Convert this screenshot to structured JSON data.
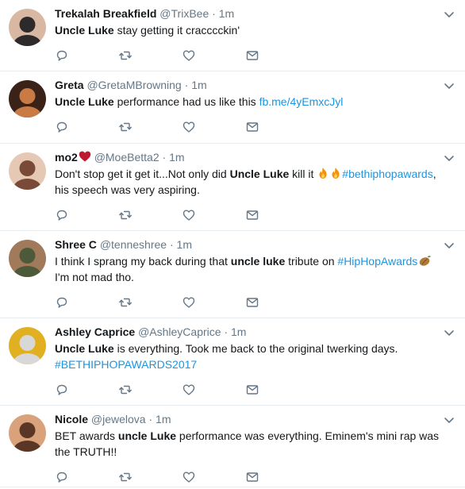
{
  "tweets": [
    {
      "name": "Trekalah Breakfield",
      "handle": "@TrixBee",
      "time": "1m",
      "segments": [
        {
          "t": "Uncle Luke",
          "s": "bold"
        },
        {
          "t": " stay getting it cracccckin'",
          "s": "plain"
        }
      ],
      "avatar_colors": [
        "#2c2a2b",
        "#d9b8a3"
      ]
    },
    {
      "name": "Greta",
      "handle": "@GretaMBrowning",
      "time": "1m",
      "segments": [
        {
          "t": "Uncle Luke",
          "s": "bold"
        },
        {
          "t": " performance had us like this ",
          "s": "plain"
        },
        {
          "t": "fb.me/4yEmxcJyl",
          "s": "link"
        }
      ],
      "avatar_colors": [
        "#c97a45",
        "#3a2218"
      ]
    },
    {
      "name": "mo2",
      "handle": "@MoeBetta2",
      "time": "1m",
      "segments": [
        {
          "t": "Don't stop get it get it...Not only did ",
          "s": "plain"
        },
        {
          "t": "Uncle Luke",
          "s": "bold"
        },
        {
          "t": " kill it ",
          "s": "plain"
        },
        {
          "t": "fire-emoji",
          "s": "emoji"
        },
        {
          "t": "fire-emoji",
          "s": "emoji"
        },
        {
          "t": "#bethiphopawards",
          "s": "link"
        },
        {
          "t": ", his speech was very aspiring.",
          "s": "plain"
        }
      ],
      "avatar_colors": [
        "#7a4a38",
        "#e6c9b4"
      ]
    },
    {
      "name": "Shree C",
      "handle": "@tenneshree",
      "time": "1m",
      "segments": [
        {
          "t": "I think I sprang my back during that ",
          "s": "plain"
        },
        {
          "t": "uncle luke",
          "s": "bold"
        },
        {
          "t": " tribute on ",
          "s": "plain"
        },
        {
          "t": "#HipHopAwards",
          "s": "link"
        },
        {
          "t": "peach-emoji",
          "s": "emoji"
        },
        {
          "t": " I'm not mad tho.",
          "s": "plain"
        }
      ],
      "avatar_colors": [
        "#4c5a3a",
        "#a07a5a"
      ]
    },
    {
      "name": "Ashley Caprice",
      "handle": "@AshleyCaprice",
      "time": "1m",
      "segments": [
        {
          "t": "Uncle Luke",
          "s": "bold"
        },
        {
          "t": " is everything. Took me back to the original twerking days. ",
          "s": "plain"
        },
        {
          "t": "#BETHIPHOPAWARDS2017",
          "s": "link"
        }
      ],
      "avatar_colors": [
        "#d8d8d8",
        "#e0b020"
      ]
    },
    {
      "name": "Nicole",
      "handle": "@jewelova",
      "time": "1m",
      "segments": [
        {
          "t": "BET awards ",
          "s": "plain"
        },
        {
          "t": "uncle Luke",
          "s": "bold"
        },
        {
          "t": " performance was everything. Eminem's mini rap was the TRUTH!!",
          "s": "plain"
        }
      ],
      "avatar_colors": [
        "#5a3626",
        "#d9a27a"
      ]
    }
  ],
  "separator": "·",
  "icons": {
    "reply": "reply-icon",
    "retweet": "retweet-icon",
    "like": "like-icon",
    "dm": "direct-message-icon",
    "more": "chevron-down-icon"
  },
  "colors": {
    "link": "#1b95e0",
    "secondary": "#657786",
    "icon": "#657786",
    "border": "#e6ecf0"
  }
}
